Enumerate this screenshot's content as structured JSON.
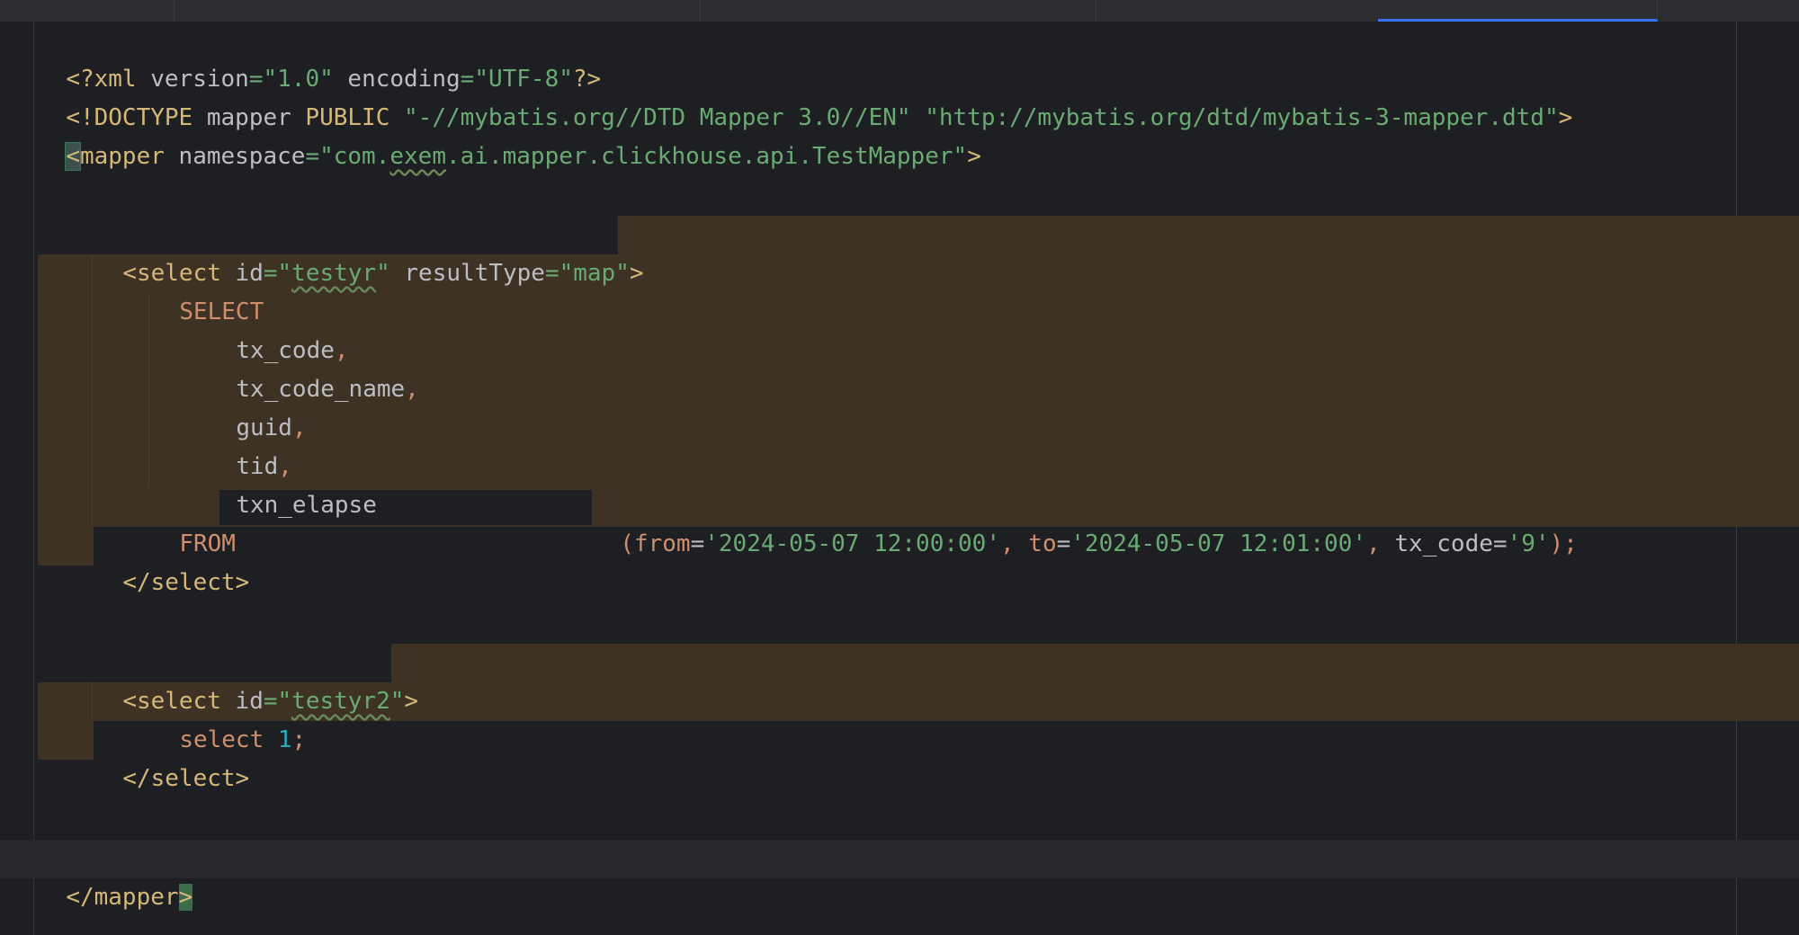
{
  "editor": {
    "lines": {
      "xml_decl": {
        "open": "<?xml",
        "version_attr": " version",
        "eq1": "=",
        "version_val": "\"1.0\"",
        "encoding_attr": " encoding",
        "eq2": "=",
        "encoding_val": "\"UTF-8\"",
        "close": "?>"
      },
      "doctype": {
        "open": "<!DOCTYPE",
        "name": " mapper",
        "public": " PUBLIC",
        "space1": " ",
        "public_id": "\"-//mybatis.org//DTD Mapper 3.0//EN\"",
        "space2": " ",
        "system_id": "\"http://mybatis.org/dtd/mybatis-3-mapper.dtd\"",
        "close": ">"
      },
      "mapper_open": {
        "lt": "<",
        "tag": "mapper",
        "attr": " namespace",
        "eq": "=",
        "val_start": "\"com.",
        "val_warn": "exem",
        "val_end": ".ai.mapper.clickhouse.api.TestMapper\"",
        "gt": ">"
      },
      "select1_open": {
        "lt": "<",
        "tag": "select",
        "id_attr": " id",
        "eq1": "=",
        "id_q1": "\"",
        "id_val": "testyr",
        "id_q2": "\"",
        "type_attr": " resultType",
        "eq2": "=",
        "type_val": "\"map\"",
        "gt": ">"
      },
      "sql_select": "SELECT",
      "col1": "tx_code",
      "col2": "tx_code_name",
      "col3": "guid",
      "col4": "tid",
      "col5": "txn_elapse",
      "comma": ",",
      "sql_from": "FROM",
      "from_args": {
        "paren_open": "(",
        "p1_name": "from",
        "eq1": "=",
        "p1_val": "'2024-05-07 12:00:00'",
        "sep1": ", ",
        "p2_name": "to",
        "eq2": "=",
        "p2_val": "'2024-05-07 12:01:00'",
        "sep2": ", ",
        "p3_name": "tx_code",
        "eq3": "=",
        "p3_val": "'9'",
        "paren_close": ")",
        "semi": ";"
      },
      "select1_close": {
        "lt": "</",
        "tag": "select",
        "gt": ">"
      },
      "select2_open": {
        "lt": "<",
        "tag": "select",
        "id_attr": " id",
        "eq": "=",
        "id_q1": "\"",
        "id_val": "testyr2",
        "id_q2": "\"",
        "gt": ">"
      },
      "select2_body": {
        "kw": "select",
        "num": " 1",
        "semi": ";"
      },
      "select2_close": {
        "lt": "</",
        "tag": "select",
        "gt": ">"
      },
      "mapper_close": {
        "lt": "</",
        "tag": "mapper",
        "gt": ">"
      }
    },
    "colors": {
      "background": "#1e1f22",
      "tag": "#d5b778",
      "string": "#6aab73",
      "keyword": "#cf8e6d",
      "number": "#2aacb8",
      "highlight": "#3d3223",
      "tab_active": "#3574f0"
    }
  }
}
